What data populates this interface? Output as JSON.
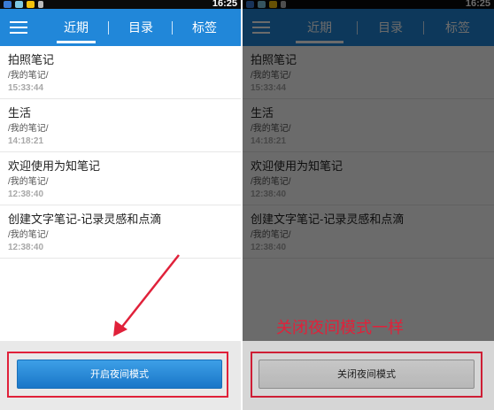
{
  "status_bar": {
    "time": "16:25"
  },
  "tabs": [
    {
      "label": "近期"
    },
    {
      "label": "目录"
    },
    {
      "label": "标签"
    }
  ],
  "notes": [
    {
      "title": "拍照笔记",
      "path": "/我的笔记/",
      "time": "15:33:44"
    },
    {
      "title": "生活",
      "path": "/我的笔记/",
      "time": "14:18:21"
    },
    {
      "title": "欢迎使用为知笔记",
      "path": "/我的笔记/",
      "time": "12:38:40"
    },
    {
      "title": "创建文字笔记-记录灵感和点滴",
      "path": "/我的笔记/",
      "time": "12:38:40"
    }
  ],
  "left_button": {
    "label": "开启夜间模式"
  },
  "right_button": {
    "label": "关闭夜间模式"
  },
  "annotation": {
    "text": "关闭夜间模式一样"
  },
  "colors": {
    "header_blue": "#2187d9",
    "annotation_red": "#e0213a"
  }
}
